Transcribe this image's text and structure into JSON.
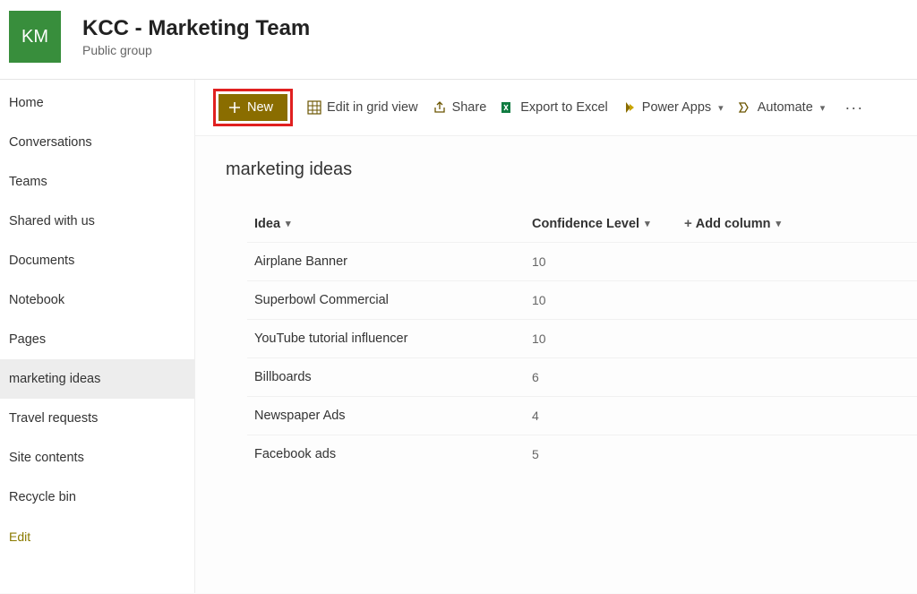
{
  "header": {
    "avatar_initials": "KM",
    "site_title": "KCC - Marketing Team",
    "subtitle": "Public group"
  },
  "sidebar": {
    "items": [
      {
        "label": "Home",
        "selected": false
      },
      {
        "label": "Conversations",
        "selected": false
      },
      {
        "label": "Teams",
        "selected": false
      },
      {
        "label": "Shared with us",
        "selected": false
      },
      {
        "label": "Documents",
        "selected": false
      },
      {
        "label": "Notebook",
        "selected": false
      },
      {
        "label": "Pages",
        "selected": false
      },
      {
        "label": "marketing ideas",
        "selected": true
      },
      {
        "label": "Travel requests",
        "selected": false
      },
      {
        "label": "Site contents",
        "selected": false
      },
      {
        "label": "Recycle bin",
        "selected": false
      }
    ],
    "edit_label": "Edit"
  },
  "toolbar": {
    "new_label": "New",
    "edit_grid_label": "Edit in grid view",
    "share_label": "Share",
    "export_label": "Export to Excel",
    "power_apps_label": "Power Apps",
    "automate_label": "Automate"
  },
  "list": {
    "title": "marketing ideas",
    "columns": {
      "idea": "Idea",
      "confidence": "Confidence Level",
      "add_column": "Add column"
    },
    "rows": [
      {
        "idea": "Airplane Banner",
        "confidence": "10"
      },
      {
        "idea": "Superbowl Commercial",
        "confidence": "10"
      },
      {
        "idea": "YouTube tutorial influencer",
        "confidence": "10"
      },
      {
        "idea": "Billboards",
        "confidence": "6"
      },
      {
        "idea": "Newspaper Ads",
        "confidence": "4"
      },
      {
        "idea": "Facebook ads",
        "confidence": "5"
      }
    ]
  }
}
